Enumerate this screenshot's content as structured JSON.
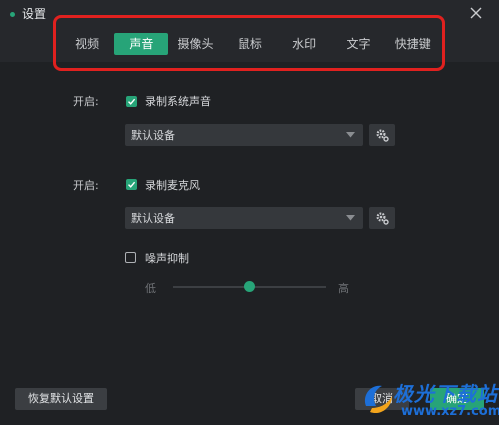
{
  "window": {
    "title": "设置"
  },
  "tabs": [
    {
      "label": "视频",
      "active": false
    },
    {
      "label": "声音",
      "active": true
    },
    {
      "label": "摄像头",
      "active": false
    },
    {
      "label": "鼠标",
      "active": false
    },
    {
      "label": "水印",
      "active": false
    },
    {
      "label": "文字",
      "active": false
    },
    {
      "label": "快捷键",
      "active": false
    }
  ],
  "system_audio": {
    "row_label": "开启:",
    "checkbox_label": "录制系统声音",
    "checked": true,
    "device": "默认设备"
  },
  "microphone": {
    "row_label": "开启:",
    "checkbox_label": "录制麦克风",
    "checked": true,
    "device": "默认设备"
  },
  "noise_suppression": {
    "checkbox_label": "噪声抑制",
    "checked": false,
    "slider_low": "低",
    "slider_high": "高",
    "level": 0.5
  },
  "footer": {
    "reset_label": "恢复默认设置",
    "cancel_label": "取消",
    "ok_label": "确定"
  },
  "watermark": {
    "text": "极光下载站",
    "url": "www.xz7.com"
  },
  "colors": {
    "accent": "#27a478",
    "background": "#1f2124",
    "header": "#26282c",
    "control": "#35383c",
    "highlight_box": "#e0211f",
    "watermark": "#1d6fd8"
  },
  "icons": {
    "title_dot": "status-dot-icon",
    "close": "close-icon",
    "dropdown": "chevron-down-icon",
    "settings": "gear-icon",
    "check": "check-icon"
  }
}
